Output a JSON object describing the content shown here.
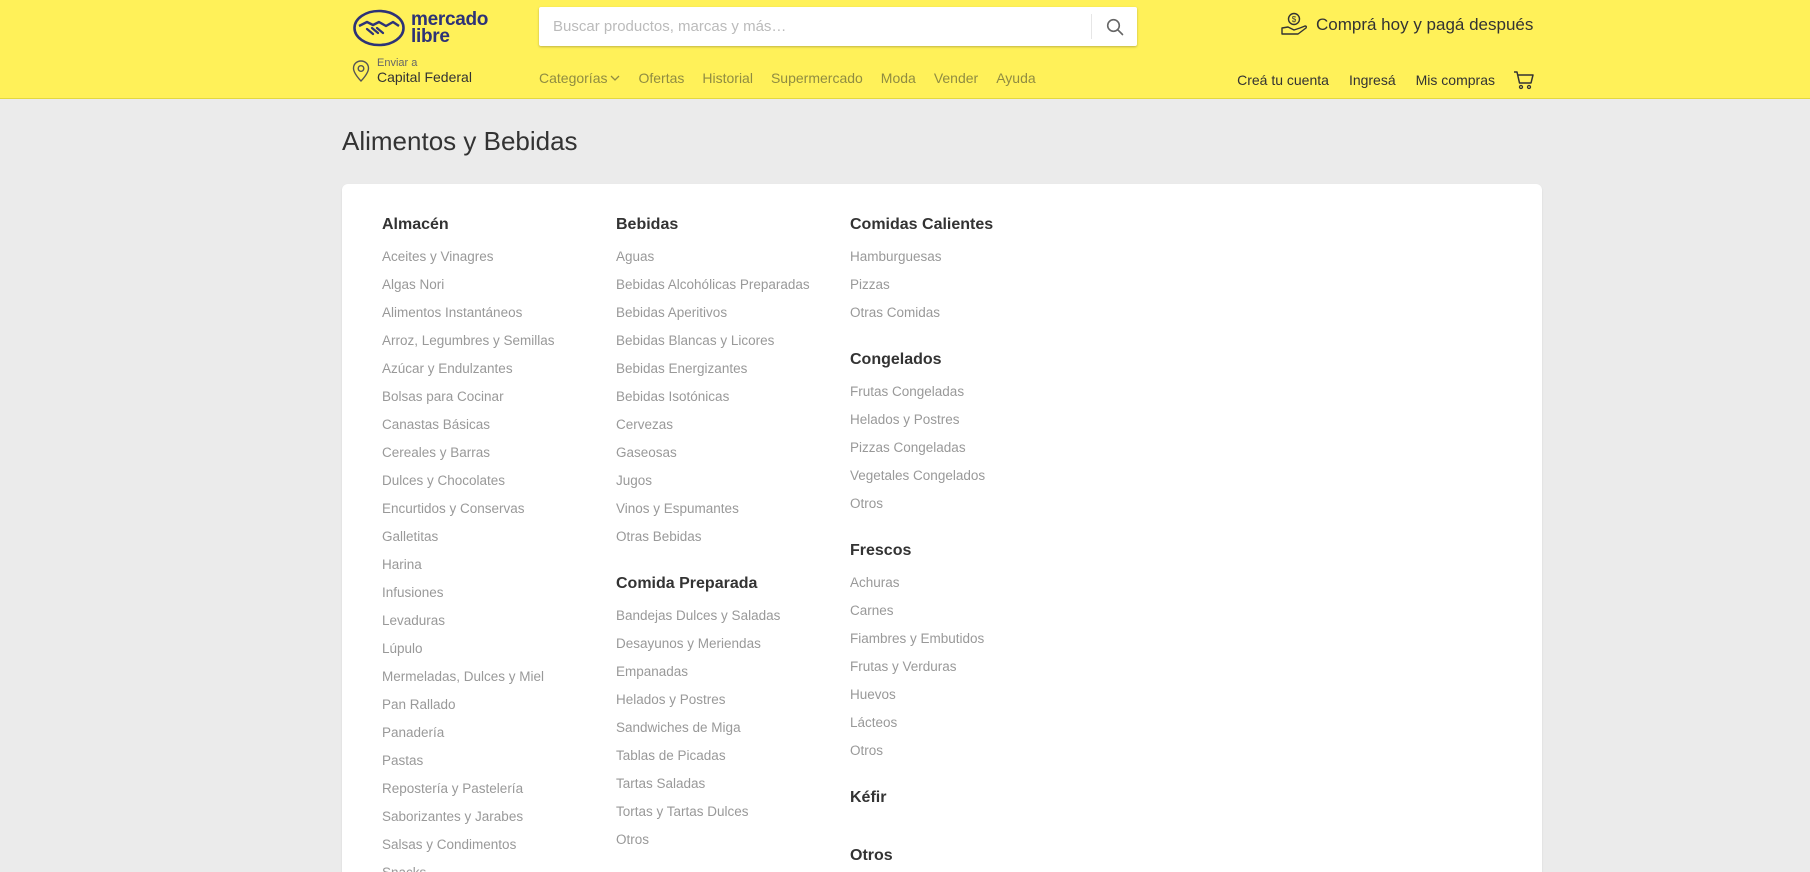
{
  "header": {
    "logo_text": [
      "mercado",
      "libre"
    ],
    "search_placeholder": "Buscar productos, marcas y más…",
    "promo_text": "Comprá hoy y pagá después",
    "location_small": "Enviar a",
    "location_big": "Capital Federal",
    "nav": [
      "Categorías",
      "Ofertas",
      "Historial",
      "Supermercado",
      "Moda",
      "Vender",
      "Ayuda"
    ],
    "user_nav": [
      "Creá tu cuenta",
      "Ingresá",
      "Mis compras"
    ],
    "colors": {
      "brand_yellow": "#fff159",
      "logo_blue": "#2d3277"
    }
  },
  "page_title": "Alimentos y Bebidas",
  "columns": [
    [
      {
        "title": "Almacén",
        "items": [
          "Aceites y Vinagres",
          "Algas Nori",
          "Alimentos Instantáneos",
          "Arroz, Legumbres y Semillas",
          "Azúcar y Endulzantes",
          "Bolsas para Cocinar",
          "Canastas Básicas",
          "Cereales y Barras",
          "Dulces y Chocolates",
          "Encurtidos y Conservas",
          "Galletitas",
          "Harina",
          "Infusiones",
          "Levaduras",
          "Lúpulo",
          "Mermeladas, Dulces y Miel",
          "Pan Rallado",
          "Panadería",
          "Pastas",
          "Repostería y Pastelería",
          "Saborizantes y Jarabes",
          "Salsas y Condimentos",
          "Snacks"
        ]
      }
    ],
    [
      {
        "title": "Bebidas",
        "items": [
          "Aguas",
          "Bebidas Alcohólicas Preparadas",
          "Bebidas Aperitivos",
          "Bebidas Blancas y Licores",
          "Bebidas Energizantes",
          "Bebidas Isotónicas",
          "Cervezas",
          "Gaseosas",
          "Jugos",
          "Vinos y Espumantes",
          "Otras Bebidas"
        ]
      },
      {
        "title": "Comida Preparada",
        "items": [
          "Bandejas Dulces y Saladas",
          "Desayunos y Meriendas",
          "Empanadas",
          "Helados y Postres",
          "Sandwiches de Miga",
          "Tablas de Picadas",
          "Tartas Saladas",
          "Tortas y Tartas Dulces",
          "Otros"
        ]
      }
    ],
    [
      {
        "title": "Comidas Calientes",
        "items": [
          "Hamburguesas",
          "Pizzas",
          "Otras Comidas"
        ]
      },
      {
        "title": "Congelados",
        "items": [
          "Frutas Congeladas",
          "Helados y Postres",
          "Pizzas Congeladas",
          "Vegetales Congelados",
          "Otros"
        ]
      },
      {
        "title": "Frescos",
        "items": [
          "Achuras",
          "Carnes",
          "Fiambres y Embutidos",
          "Frutas y Verduras",
          "Huevos",
          "Lácteos",
          "Otros"
        ]
      },
      {
        "title": "Kéfir",
        "items": []
      },
      {
        "title": "Otros",
        "items": []
      }
    ]
  ]
}
